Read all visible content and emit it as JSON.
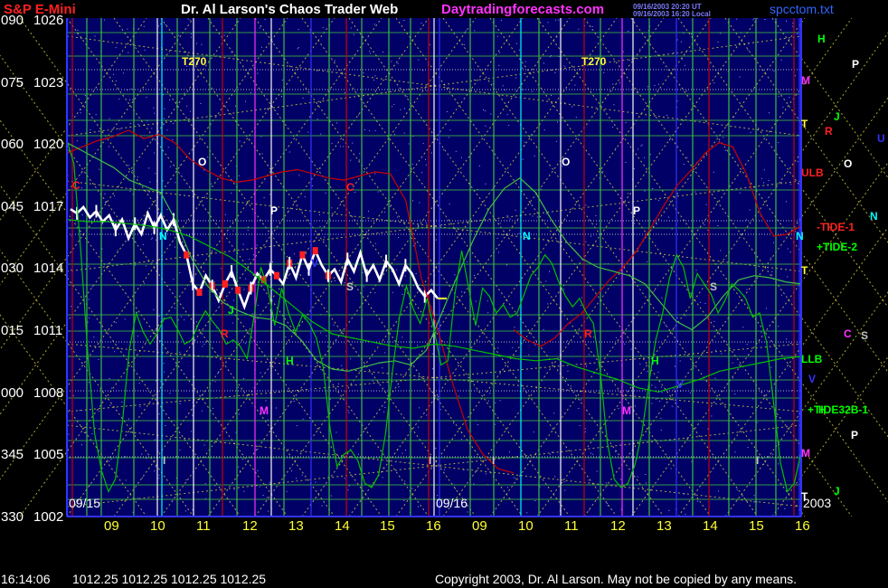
{
  "header": {
    "instrument": "S&P E-Mini",
    "site": "Dr. Al Larson's Chaos Trader Web",
    "brand": "Daytradingforecasts.com",
    "stamp1": "09/16/2003 20:20 UT",
    "stamp2": "09/16/2003 16:20 Local",
    "file": "spcctom.txt"
  },
  "footer": {
    "time": "16:14:06",
    "quote": "1012.25 1012.25 1012.25 1012.25",
    "copyright": "Copyright 2003, Dr. Al Larson. May not be copied by any means."
  },
  "colors": {
    "background": "#000066",
    "price_up": "#ffffff",
    "price_down": "#ff2020",
    "tide": "#00c000",
    "ulb_llb": "#cc0000",
    "grid_diag": "#e0e040",
    "grid_green": "#40c040"
  },
  "chart_data": {
    "type": "line",
    "title": "S&P E-Mini",
    "y_left_labels": [
      "090",
      "075",
      "060",
      "045",
      "030",
      "015",
      "000",
      "345",
      "330"
    ],
    "y_right_labels": [
      "1026",
      "1023",
      "1020",
      "1017",
      "1014",
      "1011",
      "1008",
      "1005",
      "1002"
    ],
    "ylim": [
      1002,
      1026
    ],
    "x_ticks": [
      "09",
      "10",
      "11",
      "12",
      "13",
      "14",
      "15",
      "16",
      "09",
      "10",
      "11",
      "12",
      "13",
      "14",
      "15",
      "16"
    ],
    "date_labels": [
      "09/15",
      "09/16"
    ],
    "year_label": "2003",
    "markers": [
      "T270",
      "T270",
      "O",
      "O",
      "P",
      "P",
      "C",
      "C",
      "N",
      "N",
      "S",
      "S",
      "R",
      "R",
      "H",
      "H",
      "M",
      "M",
      "J",
      "V",
      "V",
      "I",
      "I",
      "I",
      "I"
    ],
    "right_labels": [
      {
        "text": "H",
        "color": "#00ff00"
      },
      {
        "text": "P",
        "color": "#ffffff"
      },
      {
        "text": "M",
        "color": "#ff33ff"
      },
      {
        "text": "J",
        "color": "#00ff00"
      },
      {
        "text": "T",
        "color": "#ffff33"
      },
      {
        "text": "R",
        "color": "#ff2020"
      },
      {
        "text": "U",
        "color": "#3333ff"
      },
      {
        "text": "O",
        "color": "#ffffff"
      },
      {
        "text": "ULB",
        "color": "#ff2020"
      },
      {
        "text": "N",
        "color": "#00ffff"
      },
      {
        "text": "-TIDE-1",
        "color": "#ff2020"
      },
      {
        "text": "N",
        "color": "#00ffff"
      },
      {
        "text": "+TIDE-2",
        "color": "#00ff00"
      },
      {
        "text": "T",
        "color": "#ffff33"
      },
      {
        "text": "C",
        "color": "#ff33ff"
      },
      {
        "text": "S",
        "color": "#c0c0c0"
      },
      {
        "text": "LLB",
        "color": "#00ff00"
      },
      {
        "text": "V",
        "color": "#3333ff"
      },
      {
        "text": "+TIDE32B-1",
        "color": "#00ff00"
      },
      {
        "text": "H",
        "color": "#00ff00"
      },
      {
        "text": "P",
        "color": "#ffffff"
      },
      {
        "text": "M",
        "color": "#ff33ff"
      },
      {
        "text": "T",
        "color": "#ffffff"
      },
      {
        "text": "J",
        "color": "#00ff00"
      }
    ],
    "series": [
      {
        "values": [
          1016.8,
          1016.6,
          1016.9,
          1016.4,
          1016.7,
          1016.2,
          1016.5,
          1015.8,
          1016.3,
          1015.4,
          1016.1,
          1015.6,
          1016.6,
          1015.9,
          1016.5,
          1015.8,
          1016.3,
          1015.2,
          1014.6,
          1013.2,
          1012.8,
          1013.6,
          1013.1,
          1012.4,
          1013.2,
          1013.8,
          1012.9,
          1012.1,
          1013.0,
          1013.7,
          1013.4,
          1013.9,
          1013.6,
          1013.2,
          1014.2,
          1013.5,
          1014.6,
          1013.9,
          1014.8,
          1014.1,
          1013.6,
          1013.9,
          1013.3,
          1014.4,
          1013.8,
          1014.7,
          1013.6,
          1014.1,
          1013.4,
          1014.3,
          1013.9,
          1013.2,
          1014.1,
          1013.7,
          1013.0,
          1012.6,
          1012.9,
          1012.5
        ]
      },
      {
        "values": [
          1019.5,
          1019.8,
          1020.1,
          1020.3,
          1020.6,
          1020.2,
          1020.4,
          1020.0,
          1019.2,
          1018.7,
          1018.3,
          1018.1,
          1018.2,
          1018.4,
          1018.6,
          1018.7,
          1018.5,
          1018.3,
          1018.2,
          1018.4,
          1018.6,
          1018.5,
          1017.2,
          1013.5,
          1011.2,
          1008.5,
          1006.2,
          1005.0,
          1004.3,
          1004.1
        ]
      },
      {
        "values": [
          1011.0,
          1010.5,
          1010.2,
          1010.6,
          1011.3,
          1011.8,
          1012.6,
          1013.4,
          1014.0,
          1014.8,
          1015.9,
          1017.0,
          1018.0,
          1018.7,
          1019.5,
          1020.0,
          1019.8,
          1018.5,
          1016.6,
          1015.5,
          1015.6,
          1016.0
        ]
      },
      {
        "values": [
          1020.0,
          1019.6,
          1019.2,
          1018.8,
          1018.2,
          1017.9,
          1017.6,
          1016.2,
          1014.4,
          1013.1,
          1012.3,
          1011.9,
          1011.6,
          1011.5,
          1011.2,
          1010.5,
          1009.5,
          1009.1,
          1009.0,
          1009.2,
          1009.4,
          1009.5,
          1009.3,
          1010.0,
          1011.8,
          1013.6,
          1015.3,
          1016.8,
          1017.8,
          1018.3,
          1017.6,
          1016.3,
          1015.2,
          1014.4,
          1014.0,
          1013.8,
          1013.6,
          1013.2,
          1012.3,
          1011.4,
          1011.0,
          1011.6,
          1012.6,
          1013.4,
          1013.6,
          1013.5,
          1013.3,
          1013.2
        ]
      },
      {
        "values": [
          1020.1,
          1019.0,
          1014.8,
          1009.9,
          1006.0,
          1004.2,
          1003.2,
          1003.8,
          1006.5,
          1010.0,
          1011.8,
          1010.9,
          1010.3,
          1010.8,
          1011.5,
          1011.6,
          1011.0,
          1010.3,
          1010.5,
          1011.3,
          1011.9,
          1011.4,
          1011.0,
          1010.3,
          1010.5,
          1010.2,
          1009.6,
          1011.6,
          1014.0,
          1013.0,
          1011.2,
          1013.0,
          1011.8,
          1010.9,
          1011.7,
          1011.3,
          1010.6,
          1009.2,
          1006.2,
          1004.4,
          1005.0,
          1005.2,
          1004.7,
          1003.6,
          1003.4,
          1004.0,
          1006.0,
          1009.0,
          1011.6,
          1013.1,
          1012.0,
          1011.3,
          1012.5,
          1011.0,
          1009.3,
          1009.5,
          1012.7,
          1014.8,
          1013.0,
          1011.2,
          1013.0,
          1012.6,
          1011.8,
          1012.2,
          1011.6,
          1011.8,
          1012.7,
          1013.6,
          1014.0,
          1014.6,
          1014.2,
          1013.3,
          1012.6,
          1012.1,
          1012.5,
          1011.8,
          1011.3,
          1009.0,
          1005.6,
          1003.8,
          1003.4,
          1003.6,
          1004.5,
          1006.0,
          1008.4,
          1010.5,
          1011.8,
          1013.5,
          1014.6,
          1014.0,
          1012.5,
          1013.7,
          1013.2,
          1012.7,
          1011.8,
          1012.4,
          1013.2,
          1012.9,
          1012.5,
          1011.6,
          1011.8,
          1010.4,
          1007.5,
          1004.6,
          1003.2,
          1003.6,
          1005.1
        ]
      },
      {
        "values": [
          1016.3,
          1016.2,
          1016.2,
          1016.1,
          1016.0,
          1015.8,
          1015.5,
          1015.0,
          1014.5,
          1013.8,
          1013.0,
          1012.2,
          1011.4,
          1010.8,
          1010.6,
          1010.4,
          1010.2,
          1010.1,
          1010.3,
          1010.2,
          1010.0,
          1009.8,
          1009.6,
          1009.5,
          1009.6,
          1009.2,
          1008.9,
          1008.6,
          1008.2,
          1008.0,
          1008.3,
          1008.6,
          1009.0,
          1009.2,
          1009.4,
          1009.6,
          1009.7
        ]
      }
    ]
  }
}
